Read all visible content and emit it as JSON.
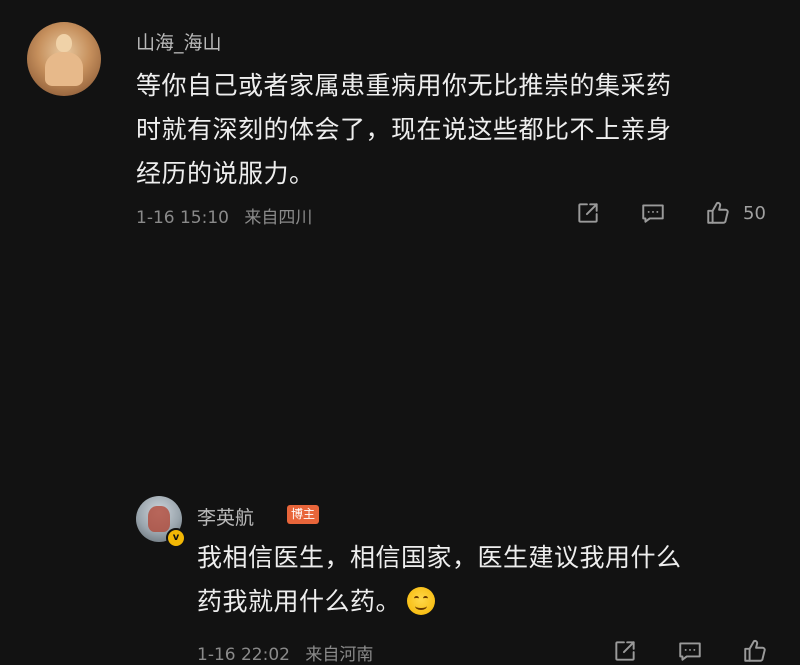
{
  "comments": [
    {
      "username": "山海_海山",
      "text_lines": [
        "等你自己或者家属患重病用你无比推崇的集采药",
        "时就有深刻的体会了，现在说这些都比不上亲身",
        "经历的说服力。"
      ],
      "time": "1-16 15:10",
      "location": "来自四川",
      "like_count": "50",
      "icons": {
        "avatar": "avatar",
        "share": "share-icon",
        "reply": "comment-icon",
        "like": "thumbs-up-icon"
      }
    },
    {
      "username": "李英航",
      "author_tag": "博主",
      "text_lines": [
        "我相信医生，相信国家，医生建议我用什么",
        "药我就用什么药。"
      ],
      "emoji": "smile-emoji",
      "time": "1-16 22:02",
      "location": "来自河南",
      "icons": {
        "avatar": "avatar",
        "verified": "verified-badge-icon",
        "share": "share-icon",
        "reply": "comment-icon",
        "like": "thumbs-up-icon"
      }
    }
  ],
  "colors": {
    "background": "#121212",
    "text": "#eeeeee",
    "secondary": "#8a8a8a",
    "author_tag_bg": "#e8653a",
    "verified_badge": "#f2b705"
  }
}
